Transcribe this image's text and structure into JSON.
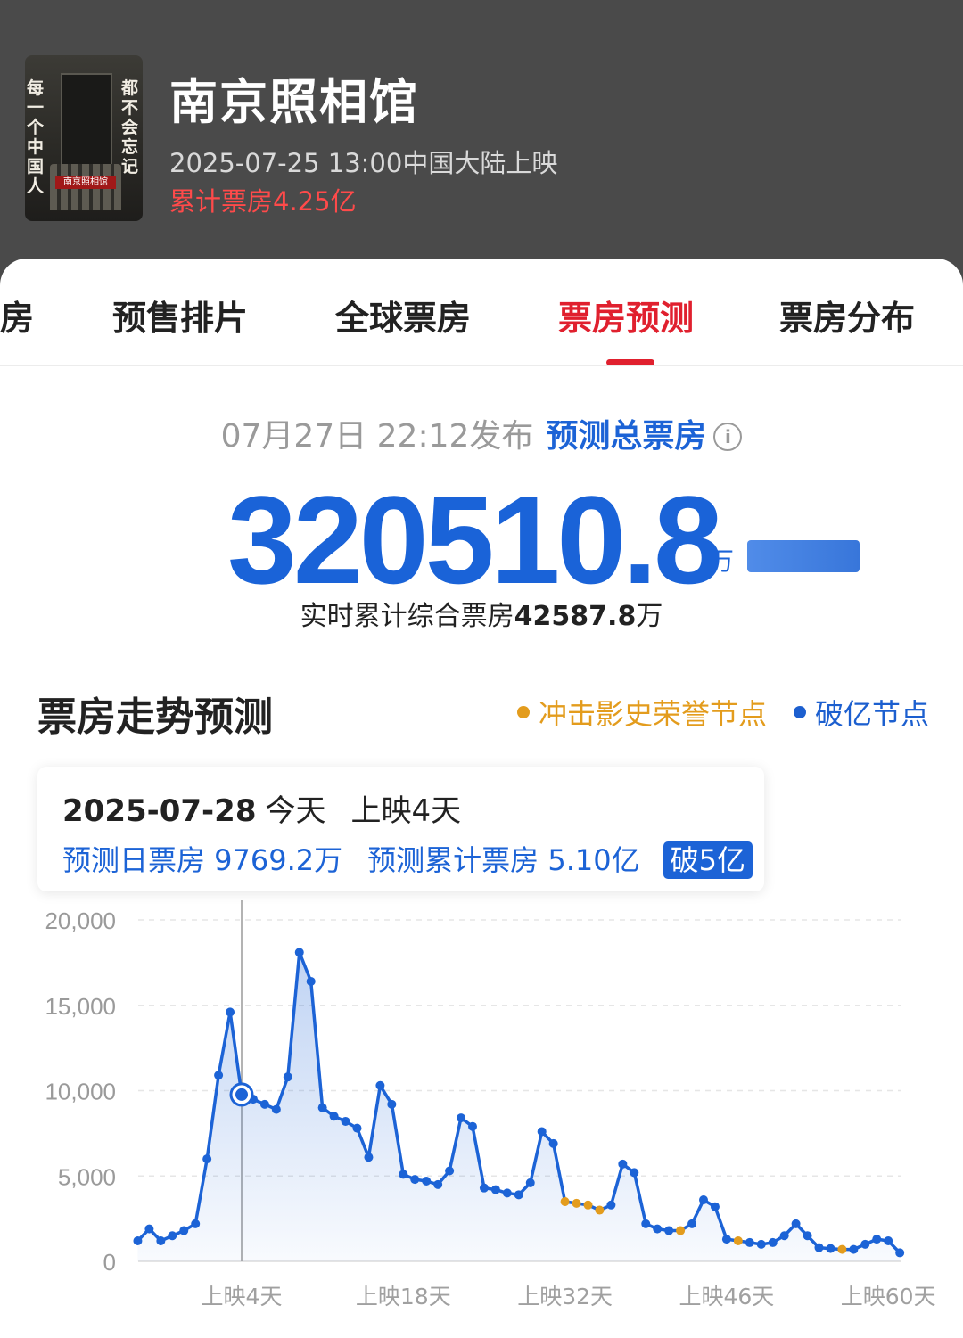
{
  "movie": {
    "title": "南京照相馆",
    "release": "2025-07-25 13:00中国大陆上映",
    "cumulative": "累计票房4.25亿",
    "poster_text_left": "每一个中国人",
    "poster_text_right": "都不会忘记",
    "poster_seal": "南京照相馆"
  },
  "tabs": [
    {
      "label": "房",
      "active": false
    },
    {
      "label": "预售排片",
      "active": false
    },
    {
      "label": "全球票房",
      "active": false
    },
    {
      "label": "票房预测",
      "active": true
    },
    {
      "label": "票房分布",
      "active": false
    }
  ],
  "forecast": {
    "publish_time": "07月27日 22:12发布",
    "label": "预测总票房",
    "total": "320510.8",
    "unit": "万",
    "realtime_prefix": "实时累计综合票房",
    "realtime_value": "42587.8",
    "realtime_unit": "万"
  },
  "trend": {
    "title": "票房走势预测",
    "legend": [
      {
        "label": "冲击影史荣誉节点",
        "color": "#e39c1d"
      },
      {
        "label": "破亿节点",
        "color": "#1c5fcf"
      }
    ]
  },
  "tooltip": {
    "date": "2025-07-28",
    "today": "今天",
    "day": "上映4天",
    "daily": "预测日票房 9769.2万",
    "cum": "预测累计票房 5.10亿",
    "badge": "破5亿"
  },
  "chart_data": {
    "type": "line",
    "ylim": [
      0,
      20000
    ],
    "yticks": [
      "20,000",
      "15,000",
      "10,000",
      "5,000",
      "0"
    ],
    "xticks": [
      {
        "day": 4,
        "label": "上映4天"
      },
      {
        "day": 18,
        "label": "上映18天"
      },
      {
        "day": 32,
        "label": "上映32天"
      },
      {
        "day": 46,
        "label": "上映46天"
      },
      {
        "day": 60,
        "label": "上映60天"
      }
    ],
    "grid": true,
    "selected_day": 4,
    "x": [
      -5,
      -4,
      -3,
      -2,
      -1,
      0,
      1,
      2,
      3,
      4,
      5,
      6,
      7,
      8,
      9,
      10,
      11,
      12,
      13,
      14,
      15,
      16,
      17,
      18,
      19,
      20,
      21,
      22,
      23,
      24,
      25,
      26,
      27,
      28,
      29,
      30,
      31,
      32,
      33,
      34,
      35,
      36,
      37,
      38,
      39,
      40,
      41,
      42,
      43,
      44,
      45,
      46,
      47,
      48,
      49,
      50,
      51,
      52,
      53,
      54,
      55,
      56,
      57,
      58,
      59,
      60,
      61
    ],
    "values": [
      1200,
      1900,
      1200,
      1500,
      1800,
      2200,
      6000,
      10900,
      14600,
      9769,
      9500,
      9200,
      8900,
      10800,
      18100,
      16400,
      9000,
      8500,
      8200,
      7800,
      6100,
      10300,
      9200,
      5100,
      4800,
      4700,
      4500,
      5300,
      8400,
      7900,
      4300,
      4200,
      4000,
      3900,
      4600,
      7600,
      6900,
      3500,
      3400,
      3300,
      3000,
      3300,
      5700,
      5200,
      2200,
      1900,
      1800,
      1800,
      2200,
      3600,
      3200,
      1300,
      1200,
      1100,
      1000,
      1100,
      1500,
      2200,
      1500,
      800,
      750,
      700,
      700,
      1000,
      1300,
      1200,
      500,
      500
    ],
    "honor_days": [
      32,
      33,
      34,
      35,
      42,
      47,
      56,
      64
    ]
  }
}
